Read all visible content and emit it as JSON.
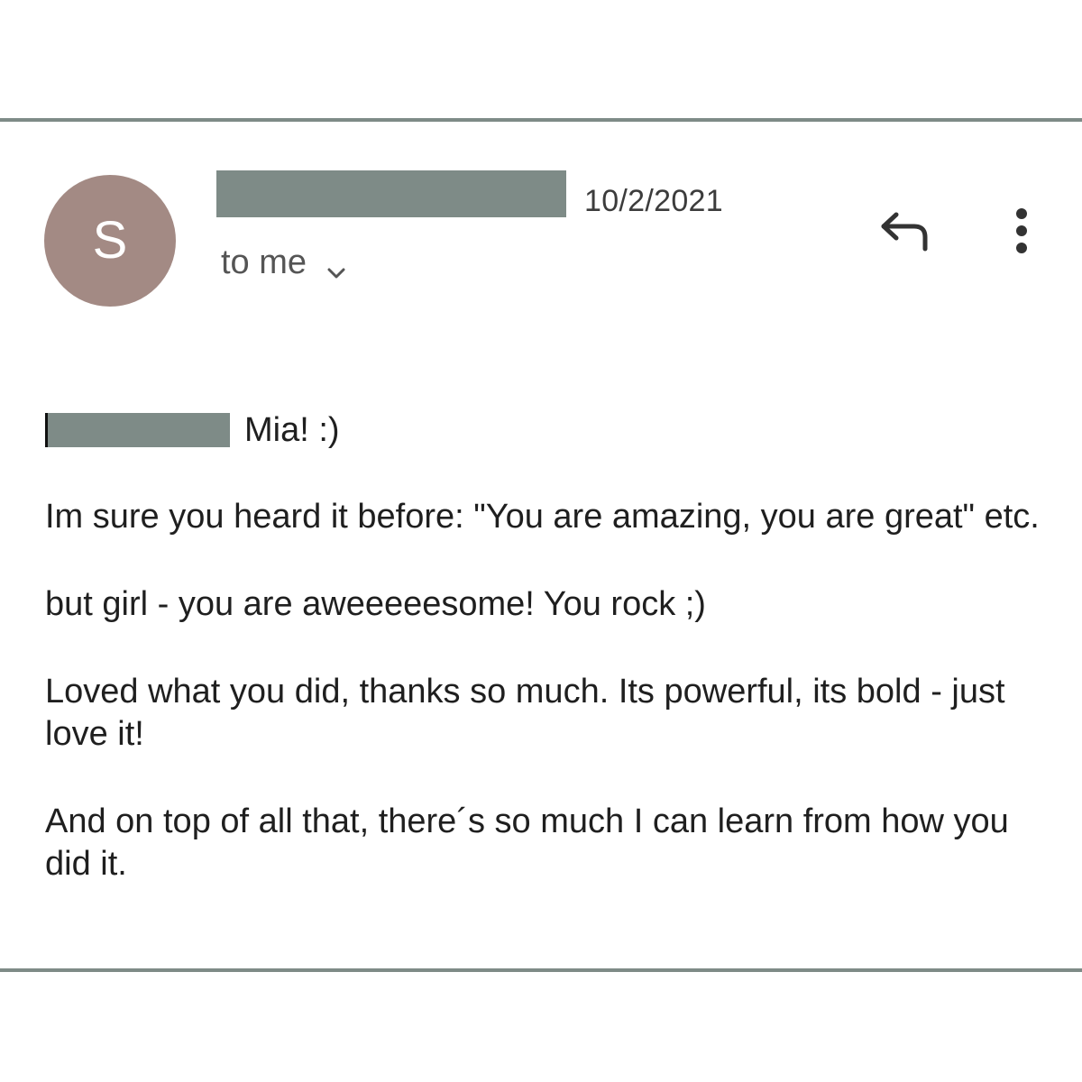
{
  "email": {
    "sender_initial": "S",
    "date": "10/2/2021",
    "recipient_label": "to me",
    "greeting_name": "Mia! :)",
    "paragraphs": [
      "Im sure you heard it before: \"You are amazing, you are great\" etc.",
      "but girl - you are aweeeeesome! You rock ;)",
      "Loved what you did, thanks so much. Its powerful, its bold - just love it!",
      "And on top of all that, there´s so much I can learn from how you did it."
    ]
  },
  "icons": {
    "reply": "reply-icon",
    "more": "more-vertical-icon",
    "expand": "chevron-down-icon"
  },
  "colors": {
    "avatar_background": "#a38a84",
    "redaction": "#7e8b87",
    "divider": "#7e8b87"
  }
}
